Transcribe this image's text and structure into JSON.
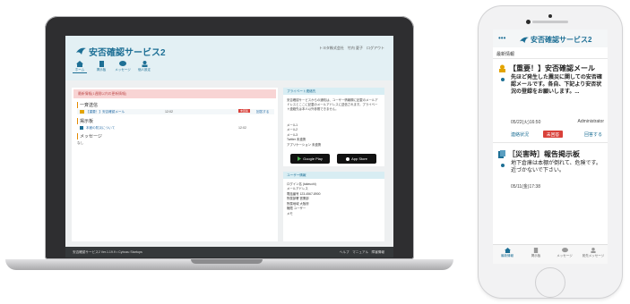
{
  "laptop": {
    "brand_title": "安否確認サービス2",
    "top_right": "トヨタ株式会社　竹内 夏子　ログアウト",
    "nav": [
      {
        "label": "ホーム",
        "icon": "home-icon"
      },
      {
        "label": "掲示板",
        "icon": "board-icon"
      },
      {
        "label": "メッセージ",
        "icon": "message-icon"
      },
      {
        "label": "個人設定",
        "icon": "user-icon"
      }
    ],
    "banner": "最新情報(1週間以内の更新情報)",
    "safety_section": "一斉送信",
    "safety_row": {
      "title": "【重要！】安否確認メール",
      "time": "12:02",
      "badge": "未回答",
      "answer": "回答する"
    },
    "board_section": "掲示板",
    "board_row": {
      "title": "本館の防災について",
      "time": "12:02"
    },
    "message_section": "メッセージ",
    "message_empty": "なし",
    "privacy_title": "プライベート連絡先",
    "privacy_text": "安否確認サービスからの通知は、ユーザー情報欄に記載のメールアドレスとここに記載のメールアドレスに送信されます。プライベート連絡先は本人以外参照できません。",
    "privacy_items": [
      "メール1",
      "メール2",
      "メール3",
      "Twitter 未連携",
      "アプリケーション 未連携"
    ],
    "googleplay": "Google Play",
    "appstore": "App Store",
    "user_title": "ユーザー情報",
    "user_items": [
      "ログイン名 (takeuchi)",
      "メールアドレス",
      "電話番号 123-4567-8900",
      "所属部署 営業部",
      "所属地域 大阪府",
      "権限 ユーザー",
      "メモ"
    ],
    "footer_left": "安否確認サービス2 Ver.1.19.9 • Cybozu Startups",
    "footer_right": "ヘルプ　マニュアル　障害情報"
  },
  "phone": {
    "more": "•••",
    "brand_title": "安否確認サービス2",
    "section": "最新情報",
    "item1": {
      "title": "【重要！】安否確認メール",
      "body": "先ほど発生した震災に関しての安否確認メールです。各自、下記より安否状況の登録をお願いします。...",
      "date": "05/22(火)16:50",
      "author": "Administrator",
      "status_link": "連絡状況",
      "badge": "未回答",
      "answer": "回答する"
    },
    "item2": {
      "title": "［災害時］報告掲示板",
      "body": "地下倉庫は本棚が倒れて、危険です。近づかないで下さい。",
      "date": "05/11(金)17:38"
    },
    "tabs": [
      {
        "label": "最新情報",
        "icon": "home-icon",
        "active": true
      },
      {
        "label": "掲示板",
        "icon": "board-icon",
        "active": false
      },
      {
        "label": "メッセージ",
        "icon": "message-icon",
        "active": false
      },
      {
        "label": "宛先メッセージ",
        "icon": "user-icon",
        "active": false
      }
    ]
  }
}
